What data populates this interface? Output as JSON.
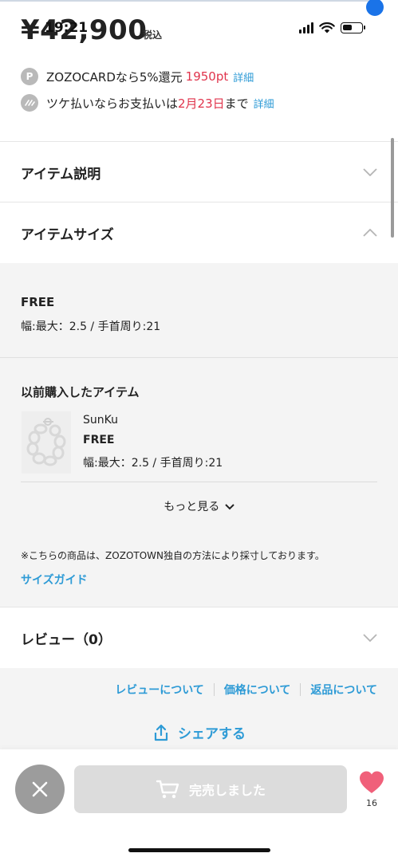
{
  "status_bar": {
    "time": "19:21"
  },
  "price": {
    "amount": "¥42,900",
    "tax_label": "税込"
  },
  "points": {
    "icon_letter": "P",
    "text": "ZOZOCARDなら5%還元",
    "points_value": "1950pt",
    "detail_link": "詳細"
  },
  "tsuke": {
    "text_before": "ツケ払いならお支払いは",
    "date": "2月23日",
    "text_after": "まで",
    "detail_link": "詳細"
  },
  "sections": {
    "item_description": "アイテム説明",
    "item_size": "アイテムサイズ",
    "review": "レビュー（0）"
  },
  "size_info": {
    "size": "FREE",
    "measurements": "幅:最大：2.5 / 手首周り:21"
  },
  "previous_purchase": {
    "title": "以前購入したアイテム",
    "brand": "SunKu",
    "size": "FREE",
    "measurements": "幅:最大：2.5 / 手首周り:21",
    "more_label": "もっと見る"
  },
  "note": "※こちらの商品は、ZOZOTOWN独自の方法により採寸しております。",
  "size_guide_link": "サイズガイド",
  "footer_links": [
    "レビューについて",
    "価格について",
    "返品について"
  ],
  "share_label": "シェアする",
  "bottom_bar": {
    "sold_out_label": "完売しました",
    "favorite_count": "16"
  },
  "colors": {
    "accent_blue": "#2e9bd6",
    "highlight_red": "#e0344c",
    "heart_pink": "#f0607a"
  }
}
